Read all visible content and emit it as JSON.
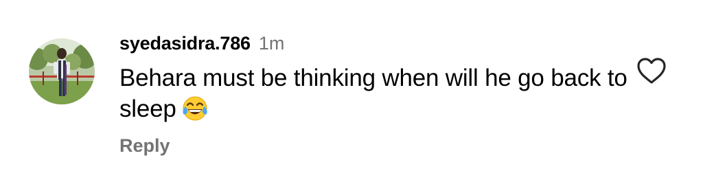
{
  "comment": {
    "username": "syedasidra.786",
    "timestamp": "1m",
    "text": "Behara must be thinking when will he go back to sleep",
    "emoji": "face-with-tears-of-joy",
    "reply_label": "Reply",
    "like_icon": "heart-outline-icon"
  },
  "colors": {
    "text": "#000000",
    "secondary": "#737373",
    "background": "#ffffff"
  }
}
